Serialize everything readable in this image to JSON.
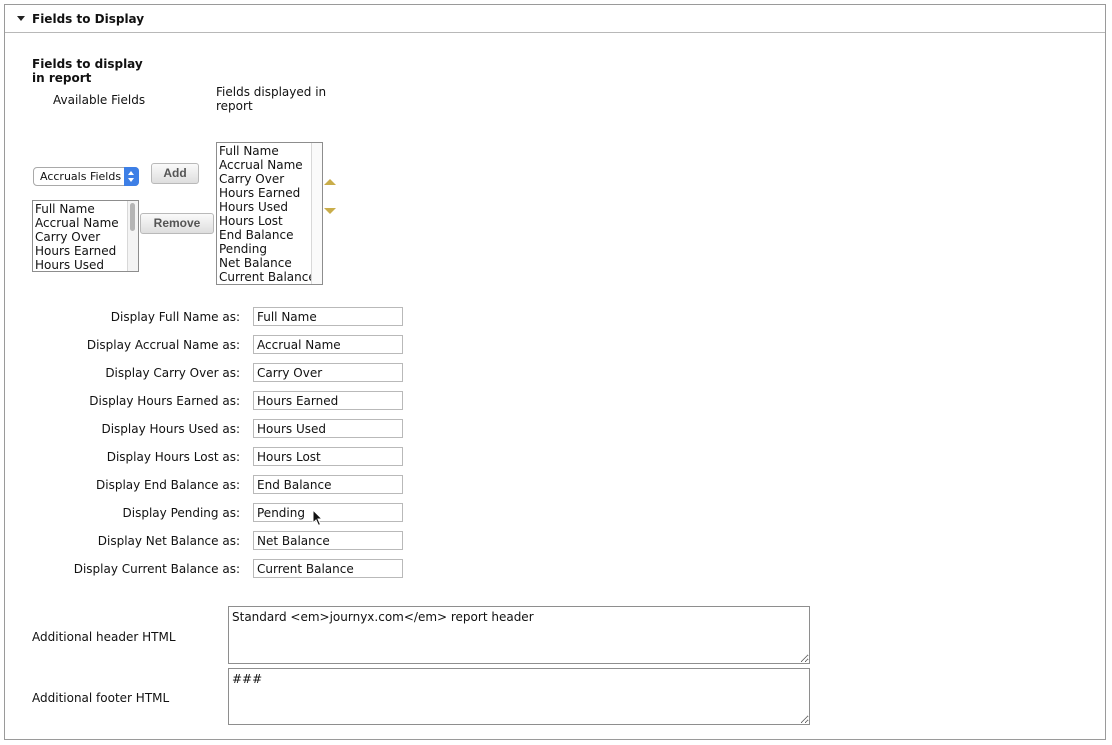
{
  "section": {
    "title": "Fields to Display"
  },
  "fields_heading": "Fields to display in report",
  "available_label": "Available Fields",
  "displayed_label": "Fields displayed in report",
  "field_group_select": {
    "selected": "Accruals Fields"
  },
  "available_fields": [
    "Full Name",
    "Accrual Name",
    "Carry Over",
    "Hours Earned",
    "Hours Used"
  ],
  "buttons": {
    "add": "Add",
    "remove": "Remove"
  },
  "displayed_fields": [
    "Full Name",
    "Accrual Name",
    "Carry Over",
    "Hours Earned",
    "Hours Used",
    "Hours Lost",
    "End Balance",
    "Pending",
    "Net Balance",
    "Current Balance"
  ],
  "display_rows": [
    {
      "label": "Display Full Name as:",
      "value": "Full Name"
    },
    {
      "label": "Display Accrual Name as:",
      "value": "Accrual Name"
    },
    {
      "label": "Display Carry Over as:",
      "value": "Carry Over"
    },
    {
      "label": "Display Hours Earned as:",
      "value": "Hours Earned"
    },
    {
      "label": "Display Hours Used as:",
      "value": "Hours Used"
    },
    {
      "label": "Display Hours Lost as:",
      "value": "Hours Lost"
    },
    {
      "label": "Display End Balance as:",
      "value": "End Balance"
    },
    {
      "label": "Display Pending as:",
      "value": "Pending"
    },
    {
      "label": "Display Net Balance as:",
      "value": "Net Balance"
    },
    {
      "label": "Display Current Balance as:",
      "value": "Current Balance"
    }
  ],
  "header_html": {
    "label": "Additional header HTML",
    "value": "Standard <em>journyx.com</em> report header"
  },
  "footer_html": {
    "label": "Additional footer HTML",
    "value": "###"
  },
  "icons": {
    "collapse": "triangle-down-icon",
    "move_up": "arrow-up-icon",
    "move_down": "arrow-down-icon",
    "cursor": "mouse-pointer-icon"
  },
  "colors": {
    "select_accent": "#3d7fe6",
    "arrow_color": "#c9ad4a"
  }
}
